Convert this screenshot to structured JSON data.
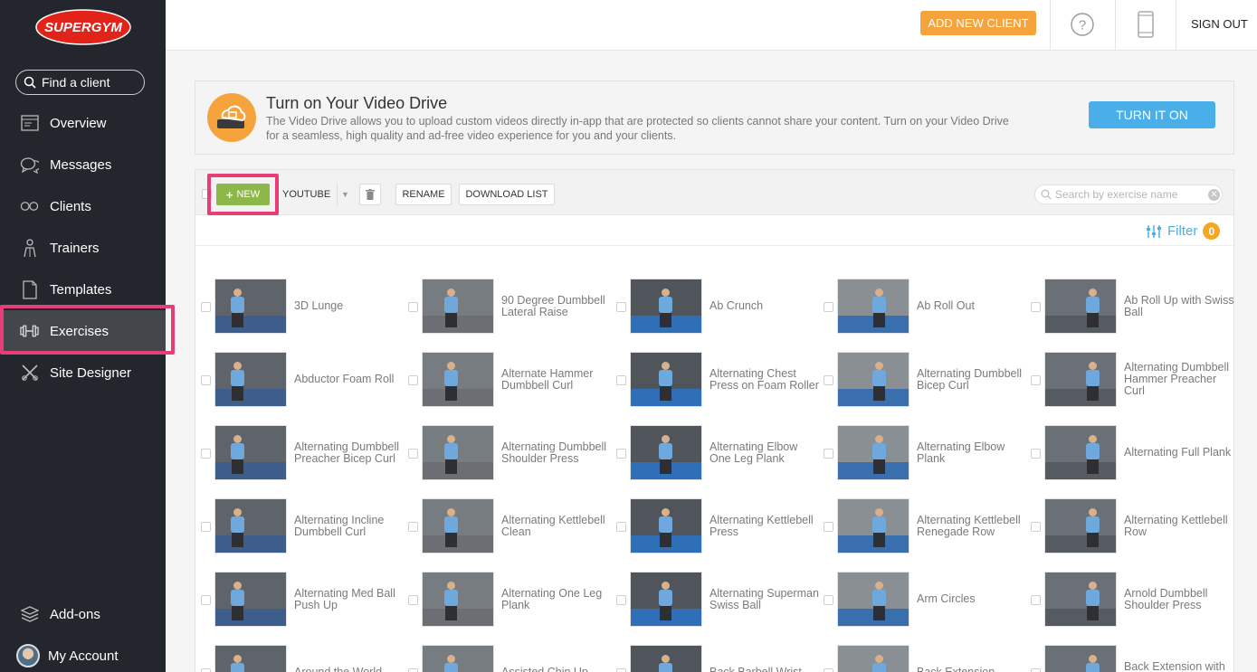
{
  "sidebar": {
    "logo_text": "SUPERGYM",
    "search_label": "Find a client",
    "items": [
      {
        "label": "Overview",
        "icon": "overview-icon"
      },
      {
        "label": "Messages",
        "icon": "chat-bubbles-icon"
      },
      {
        "label": "Clients",
        "icon": "clients-icon"
      },
      {
        "label": "Trainers",
        "icon": "trainer-icon"
      },
      {
        "label": "Templates",
        "icon": "template-doc-icon"
      },
      {
        "label": "Exercises",
        "icon": "dumbbell-icon"
      },
      {
        "label": "Site Designer",
        "icon": "site-designer-icon"
      }
    ],
    "bottom": [
      {
        "label": "Add-ons",
        "icon": "layers-icon"
      },
      {
        "label": "My Account",
        "icon": "avatar"
      }
    ],
    "active_item": "Exercises"
  },
  "header": {
    "add_client_label": "ADD NEW CLIENT",
    "signout_label": "SIGN OUT",
    "help_glyph": "?"
  },
  "banner": {
    "title": "Turn on Your Video Drive",
    "text": "The Video Drive allows you to upload custom videos directly in-app that are protected so clients cannot share your content. Turn on your Video Drive for a seamless, high quality and ad-free video experience for you and your clients.",
    "button_label": "TURN IT ON"
  },
  "toolbar": {
    "new_label": "NEW",
    "new_glyph": "+",
    "source_label": "YOUTUBE",
    "rename_label": "RENAME",
    "download_label": "DOWNLOAD LIST",
    "search_placeholder": "Search by exercise name",
    "filter_label": "Filter",
    "filter_count": "0"
  },
  "colors": {
    "accent_orange": "#f5a33d",
    "accent_blue": "#4aaee8",
    "new_green": "#8cb84a",
    "highlight_pink": "#e83e78",
    "sidebar_bg": "#23262d"
  },
  "exercises": [
    [
      "3D Lunge",
      "90 Degree Dumbbell Lateral Raise",
      "Ab Crunch",
      "Ab Roll Out",
      "Ab Roll Up with Swiss Ball"
    ],
    [
      "Abductor Foam Roll",
      "Alternate Hammer Dumbbell Curl",
      "Alternating Chest Press on Foam Roller",
      "Alternating Dumbbell Bicep Curl",
      "Alternating Dumbbell Hammer Preacher Curl"
    ],
    [
      "Alternating Dumbbell Preacher Bicep Curl",
      "Alternating Dumbbell Shoulder Press",
      "Alternating Elbow One Leg Plank",
      "Alternating Elbow Plank",
      "Alternating Full Plank"
    ],
    [
      "Alternating Incline Dumbbell Curl",
      "Alternating Kettlebell Clean",
      "Alternating Kettlebell Press",
      "Alternating Kettlebell Renegade Row",
      "Alternating Kettlebell Row"
    ],
    [
      "Alternating Med Ball Push Up",
      "Alternating One Leg Plank",
      "Alternating Superman Swiss Ball",
      "Arm Circles",
      "Arnold Dumbbell Shoulder Press"
    ],
    [
      "Around the World",
      "Assisted Chin Up",
      "Back Barbell Wrist",
      "Back Extension",
      "Back Extension with a"
    ]
  ]
}
